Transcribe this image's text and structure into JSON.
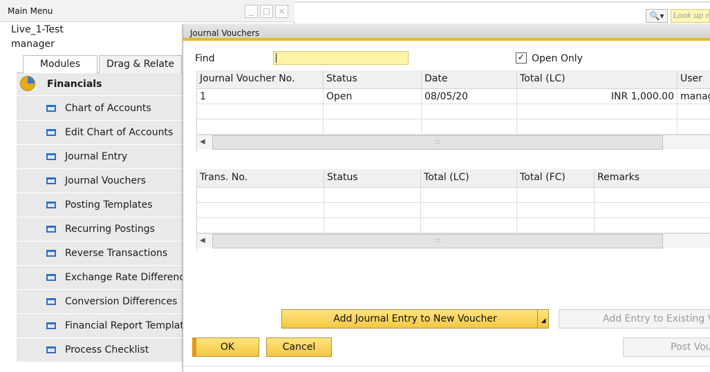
{
  "main_menu": {
    "title": "Main Menu",
    "window_controls": [
      "_",
      "□",
      "×"
    ],
    "company": "Live_1-Test",
    "user": "manager",
    "tabs": [
      {
        "label": "Modules",
        "active": true
      },
      {
        "label": "Drag & Relate",
        "active": false
      }
    ],
    "module_header": {
      "label": "Financials",
      "icon": "pie-chart-icon"
    },
    "items": [
      {
        "label": "Chart of Accounts"
      },
      {
        "label": "Edit Chart of Accounts"
      },
      {
        "label": "Journal Entry"
      },
      {
        "label": "Journal Vouchers"
      },
      {
        "label": "Posting Templates"
      },
      {
        "label": "Recurring Postings"
      },
      {
        "label": "Reverse Transactions"
      },
      {
        "label": "Exchange Rate Differences"
      },
      {
        "label": "Conversion Differences"
      },
      {
        "label": "Financial Report Templates"
      },
      {
        "label": "Process Checklist"
      }
    ]
  },
  "toolbar": {
    "lookup_placeholder": "Look up menu"
  },
  "journal_vouchers": {
    "title": "Journal Vouchers",
    "find_label": "Find",
    "find_value": "",
    "open_only_label": "Open Only",
    "open_only_checked": true,
    "voucher_grid": {
      "columns": [
        "Journal Voucher No.",
        "Status",
        "Date",
        "Total (LC)",
        "User"
      ],
      "rows": [
        [
          "1",
          "Open",
          "08/05/20",
          "INR 1,000.00",
          "manager"
        ],
        [
          "",
          "",
          "",
          "",
          ""
        ],
        [
          "",
          "",
          "",
          "",
          ""
        ]
      ]
    },
    "trans_grid": {
      "columns": [
        "Trans. No.",
        "Status",
        "Total (LC)",
        "Total (FC)",
        "Remarks"
      ],
      "rows": [
        [
          "",
          "",
          "",
          "",
          ""
        ],
        [
          "",
          "",
          "",
          "",
          ""
        ],
        [
          "",
          "",
          "",
          "",
          ""
        ]
      ]
    },
    "buttons": {
      "add_new": "Add Journal Entry to New Voucher",
      "add_existing": "Add Entry to Existing Voucher",
      "ok": "OK",
      "cancel": "Cancel",
      "post": "Post Voucher"
    }
  },
  "colors": {
    "accent": "#f0b71a",
    "button_yellow": "#f4c742",
    "input_yellow": "#fff3a6",
    "module_bg": "#e9e9e9",
    "icon_blue": "#2e6fbf"
  }
}
